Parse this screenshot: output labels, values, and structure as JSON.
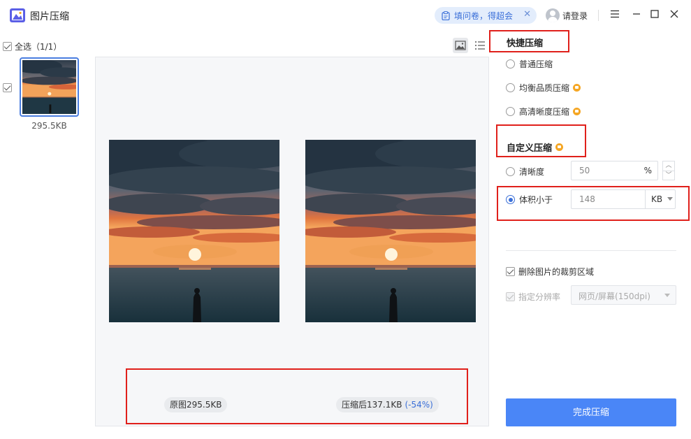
{
  "app": {
    "title": "图片压缩"
  },
  "header": {
    "survey_label": "填问卷，得超会",
    "login_label": "请登录"
  },
  "left": {
    "select_all_label": "全选（1/1）",
    "thumb_size": "295.5KB"
  },
  "preview": {
    "original_label": "原图295.5KB",
    "compressed_label": "压缩后137.1KB",
    "compressed_percent": "(-54%)"
  },
  "quick": {
    "title": "快捷压缩",
    "options": [
      "普通压缩",
      "均衡品质压缩",
      "高清晰度压缩"
    ]
  },
  "custom": {
    "title": "自定义压缩",
    "quality_label": "清晰度",
    "quality_value": "50",
    "quality_unit": "%",
    "size_label": "体积小于",
    "size_value": "148",
    "size_unit": "KB"
  },
  "extra": {
    "remove_crop_label": "删除图片的裁剪区域",
    "resolution_label": "指定分辨率",
    "resolution_value": "网页/屏幕(150dpi)"
  },
  "actions": {
    "finish_label": "完成压缩"
  },
  "colors": {
    "accent": "#4a86f7",
    "annotation": "#e0201b",
    "vip": "#f5a623"
  }
}
